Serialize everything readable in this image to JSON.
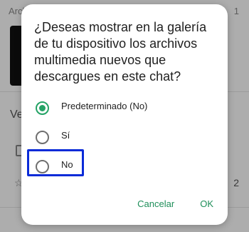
{
  "background": {
    "top_left_text": "Arch",
    "top_right_text": "1",
    "row_text": "Ve",
    "row_count": "2"
  },
  "dialog": {
    "title": "¿Deseas mostrar en la galería de tu dispositivo los archivos multimedia nuevos que descargues en este chat?",
    "options": [
      {
        "label": "Predeterminado (No)",
        "checked": true
      },
      {
        "label": "Sí",
        "checked": false
      },
      {
        "label": "No",
        "checked": false
      }
    ],
    "actions": {
      "cancel_label": "Cancelar",
      "ok_label": "OK"
    }
  },
  "colors": {
    "accent": "#25a366",
    "button_text": "#1f8f5a",
    "highlight": "#0a2bd8"
  }
}
